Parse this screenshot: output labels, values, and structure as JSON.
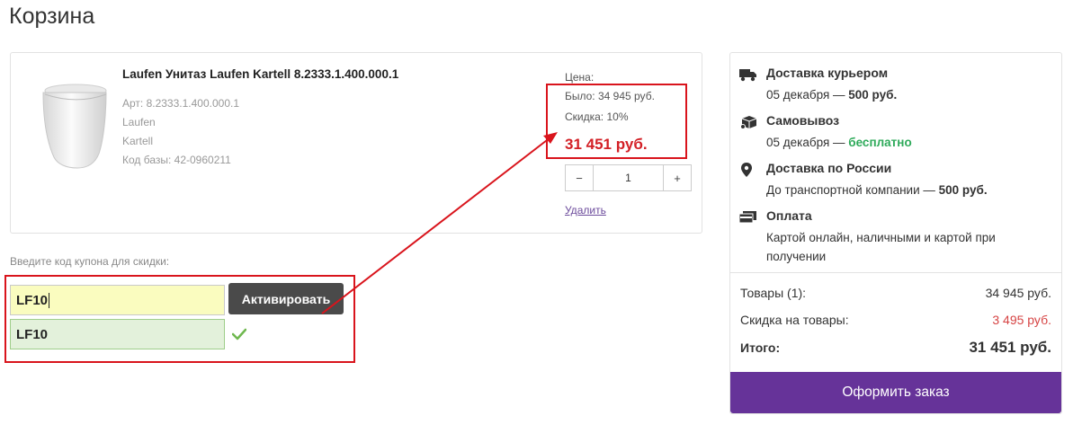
{
  "page": {
    "title": "Корзина"
  },
  "product": {
    "name": "Laufen Унитаз Laufen Kartell 8.2333.1.400.000.1",
    "article": "Арт: 8.2333.1.400.000.1",
    "brand": "Laufen",
    "collection": "Kartell",
    "base_code": "Код базы: 42-0960211",
    "price_label": "Цена:",
    "price_old": "Было: 34 945 руб.",
    "discount": "Скидка: 10%",
    "price_new": "31 451 руб.",
    "qty_minus": "−",
    "quantity": "1",
    "qty_plus": "+",
    "remove": "Удалить"
  },
  "coupon": {
    "label": "Введите код купона для скидки:",
    "input_value": "LF10",
    "activate": "Активировать",
    "applied_value": "LF10"
  },
  "summary": {
    "delivery": [
      {
        "title": "Доставка курьером",
        "icon": "truck-icon",
        "sub_prefix": "05 декабря — ",
        "sub_value": "500 руб."
      },
      {
        "title": "Самовывоз",
        "icon": "pickup-box-icon",
        "sub_prefix": "05 декабря — ",
        "sub_value": "бесплатно"
      },
      {
        "title": "Доставка по России",
        "icon": "location-pin-icon",
        "sub_prefix": "До транспортной компании — ",
        "sub_value": "500 руб."
      },
      {
        "title": "Оплата",
        "icon": "payment-card-icon",
        "sub_line1": "Картой онлайн, наличными и картой при",
        "sub_line2": "получении"
      }
    ],
    "goods_label": "Товары (1):",
    "goods_value": "34 945 руб.",
    "discount_label": "Скидка на товары:",
    "discount_value": "3 495 руб.",
    "total_label": "Итого:",
    "total_value": "31 451 руб.",
    "order_button": "Оформить заказ"
  },
  "colors": {
    "accent": "#663399",
    "price_red": "#d32026",
    "free_green": "#2eaa5a",
    "annotation_red": "#d9141c"
  }
}
